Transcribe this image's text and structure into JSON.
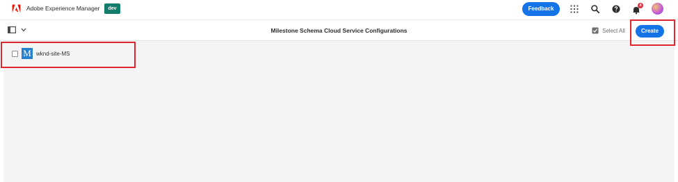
{
  "header": {
    "app_name": "Adobe Experience Manager",
    "env_badge": "dev",
    "feedback_label": "Feedback",
    "notification_count": "4",
    "icons": {
      "logo": "adobe-logo-icon",
      "apps": "apps-grid-icon",
      "search": "search-icon",
      "help": "help-icon",
      "notifications": "bell-icon",
      "avatar": "user-avatar"
    }
  },
  "actionbar": {
    "title": "Milestone Schema Cloud Service Configurations",
    "select_all_label": "Select All",
    "create_label": "Create",
    "icons": {
      "rail": "side-panel-toggle-icon",
      "chevron": "chevron-down-icon",
      "select_all": "select-all-icon"
    }
  },
  "content": {
    "items": [
      {
        "label": "wknd-site-MS",
        "thumb_letter": "M",
        "selected": false
      }
    ]
  },
  "colors": {
    "accent": "#1473e6",
    "env_badge": "#137d6b",
    "brand_red": "#eb1000",
    "highlight": "#e0262b",
    "thumb": "#2680d0",
    "content_bg": "#f4f4f4"
  }
}
